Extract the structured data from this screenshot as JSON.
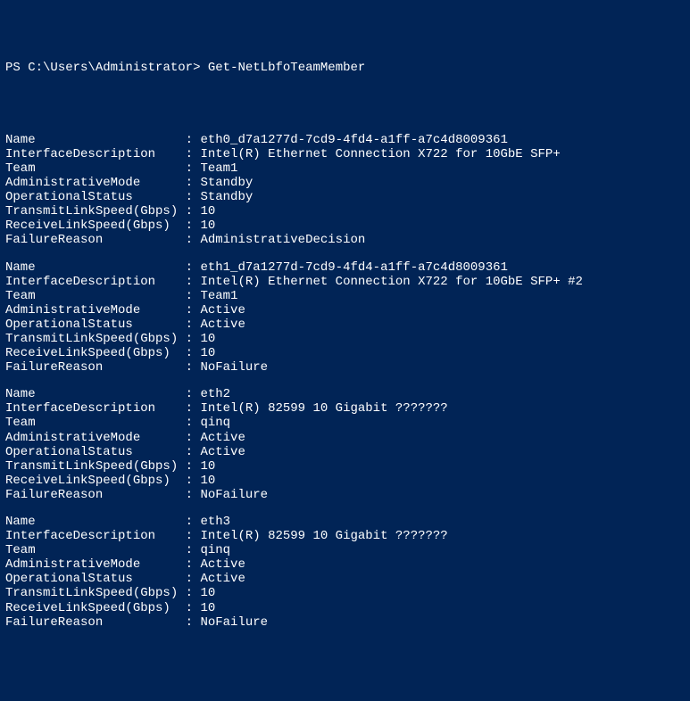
{
  "prompt": {
    "prefix": "PS ",
    "path": "C:\\Users\\Administrator",
    "suffix": "> ",
    "command": "Get-NetLbfoTeamMember"
  },
  "fields": [
    {
      "key": "Name"
    },
    {
      "key": "InterfaceDescription"
    },
    {
      "key": "Team"
    },
    {
      "key": "AdministrativeMode"
    },
    {
      "key": "OperationalStatus"
    },
    {
      "key": "TransmitLinkSpeed(Gbps)"
    },
    {
      "key": "ReceiveLinkSpeed(Gbps)"
    },
    {
      "key": "FailureReason"
    }
  ],
  "members": [
    {
      "Name": "eth0_d7a1277d-7cd9-4fd4-a1ff-a7c4d8009361",
      "InterfaceDescription": "Intel(R) Ethernet Connection X722 for 10GbE SFP+",
      "Team": "Team1",
      "AdministrativeMode": "Standby",
      "OperationalStatus": "Standby",
      "TransmitLinkSpeed(Gbps)": "10",
      "ReceiveLinkSpeed(Gbps)": "10",
      "FailureReason": "AdministrativeDecision"
    },
    {
      "Name": "eth1_d7a1277d-7cd9-4fd4-a1ff-a7c4d8009361",
      "InterfaceDescription": "Intel(R) Ethernet Connection X722 for 10GbE SFP+ #2",
      "Team": "Team1",
      "AdministrativeMode": "Active",
      "OperationalStatus": "Active",
      "TransmitLinkSpeed(Gbps)": "10",
      "ReceiveLinkSpeed(Gbps)": "10",
      "FailureReason": "NoFailure"
    },
    {
      "Name": "eth2",
      "InterfaceDescription": "Intel(R) 82599 10 Gigabit ???????",
      "Team": "qinq",
      "AdministrativeMode": "Active",
      "OperationalStatus": "Active",
      "TransmitLinkSpeed(Gbps)": "10",
      "ReceiveLinkSpeed(Gbps)": "10",
      "FailureReason": "NoFailure"
    },
    {
      "Name": "eth3",
      "InterfaceDescription": "Intel(R) 82599 10 Gigabit ???????",
      "Team": "qinq",
      "AdministrativeMode": "Active",
      "OperationalStatus": "Active",
      "TransmitLinkSpeed(Gbps)": "10",
      "ReceiveLinkSpeed(Gbps)": "10",
      "FailureReason": "NoFailure"
    }
  ],
  "separator": ":",
  "keyWidth": 24
}
